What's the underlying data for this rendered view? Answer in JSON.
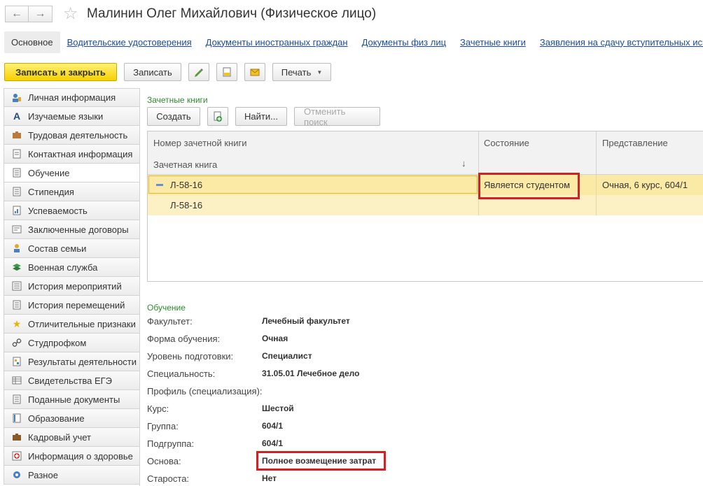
{
  "window": {
    "title": "Малинин Олег Михайлович (Физическое лицо)",
    "back_icon": "arrow-left-icon",
    "forward_icon": "arrow-right-icon",
    "favorite_icon": "star-icon"
  },
  "tabs": [
    {
      "label": "Основное",
      "active": true
    },
    {
      "label": "Водительские удостоверения"
    },
    {
      "label": "Документы иностранных граждан"
    },
    {
      "label": "Документы физ лиц"
    },
    {
      "label": "Зачетные книги"
    },
    {
      "label": "Заявления на сдачу вступительных исп"
    }
  ],
  "toolbar": {
    "save_close": "Записать и закрыть",
    "save": "Записать",
    "print": "Печать"
  },
  "sidebar": {
    "items": [
      {
        "label": "Личная информация",
        "icon": "person-card-icon"
      },
      {
        "label": "Изучаемые языки",
        "icon": "letter-a-icon"
      },
      {
        "label": "Трудовая деятельность",
        "icon": "briefcase-icon"
      },
      {
        "label": "Контактная информация",
        "icon": "contacts-icon"
      },
      {
        "label": "Обучение",
        "icon": "document-icon",
        "active": true
      },
      {
        "label": "Стипендия",
        "icon": "document-icon"
      },
      {
        "label": "Успеваемость",
        "icon": "report-icon"
      },
      {
        "label": "Заключенные договоры",
        "icon": "contract-icon"
      },
      {
        "label": "Состав семьи",
        "icon": "family-icon"
      },
      {
        "label": "Военная служба",
        "icon": "military-icon"
      },
      {
        "label": "История мероприятий",
        "icon": "list-icon"
      },
      {
        "label": "История перемещений",
        "icon": "document-icon"
      },
      {
        "label": "Отличительные признаки",
        "icon": "star-icon"
      },
      {
        "label": "Студпрофком",
        "icon": "link-icon"
      },
      {
        "label": "Результаты деятельности",
        "icon": "results-icon"
      },
      {
        "label": "Свидетельства ЕГЭ",
        "icon": "table-icon"
      },
      {
        "label": "Поданные документы",
        "icon": "document-icon"
      },
      {
        "label": "Образование",
        "icon": "book-icon"
      },
      {
        "label": "Кадровый учет",
        "icon": "briefcase-icon"
      },
      {
        "label": "Информация о здоровье",
        "icon": "health-icon"
      },
      {
        "label": "Разное",
        "icon": "misc-icon"
      }
    ]
  },
  "gradebooks": {
    "section_title": "Зачетные книги",
    "create": "Создать",
    "find": "Найти...",
    "cancel_search": "Отменить поиск",
    "columns": {
      "number": "Номер зачетной книги",
      "book": "Зачетная книга",
      "state": "Состояние",
      "representation": "Представление"
    },
    "rows": [
      {
        "number": "Л-58-16",
        "state": "Является студентом",
        "representation": "Очная, 6 курс, 604/1"
      },
      {
        "number": "Л-58-16",
        "state": "",
        "representation": ""
      }
    ]
  },
  "education": {
    "section_title": "Обучение",
    "fields": [
      {
        "label": "Факультет:",
        "value": "Лечебный факультет"
      },
      {
        "label": "Форма обучения:",
        "value": "Очная"
      },
      {
        "label": "Уровень подготовки:",
        "value": "Специалист"
      },
      {
        "label": "Специальность:",
        "value": "31.05.01 Лечебное дело"
      },
      {
        "label": "Профиль (специализация):",
        "value": ""
      },
      {
        "label": "Курс:",
        "value": "Шестой"
      },
      {
        "label": "Группа:",
        "value": "604/1"
      },
      {
        "label": "Подгруппа:",
        "value": "604/1"
      },
      {
        "label": "Основа:",
        "value": "Полное возмещение затрат"
      },
      {
        "label": "Староста:",
        "value": "Нет"
      }
    ]
  },
  "colors": {
    "primary_button": "#f5d000",
    "link": "#1b4d9c",
    "section_title": "#2e8b2e",
    "row_highlight": "#fbe9a6",
    "annotation_red": "#d42020"
  }
}
